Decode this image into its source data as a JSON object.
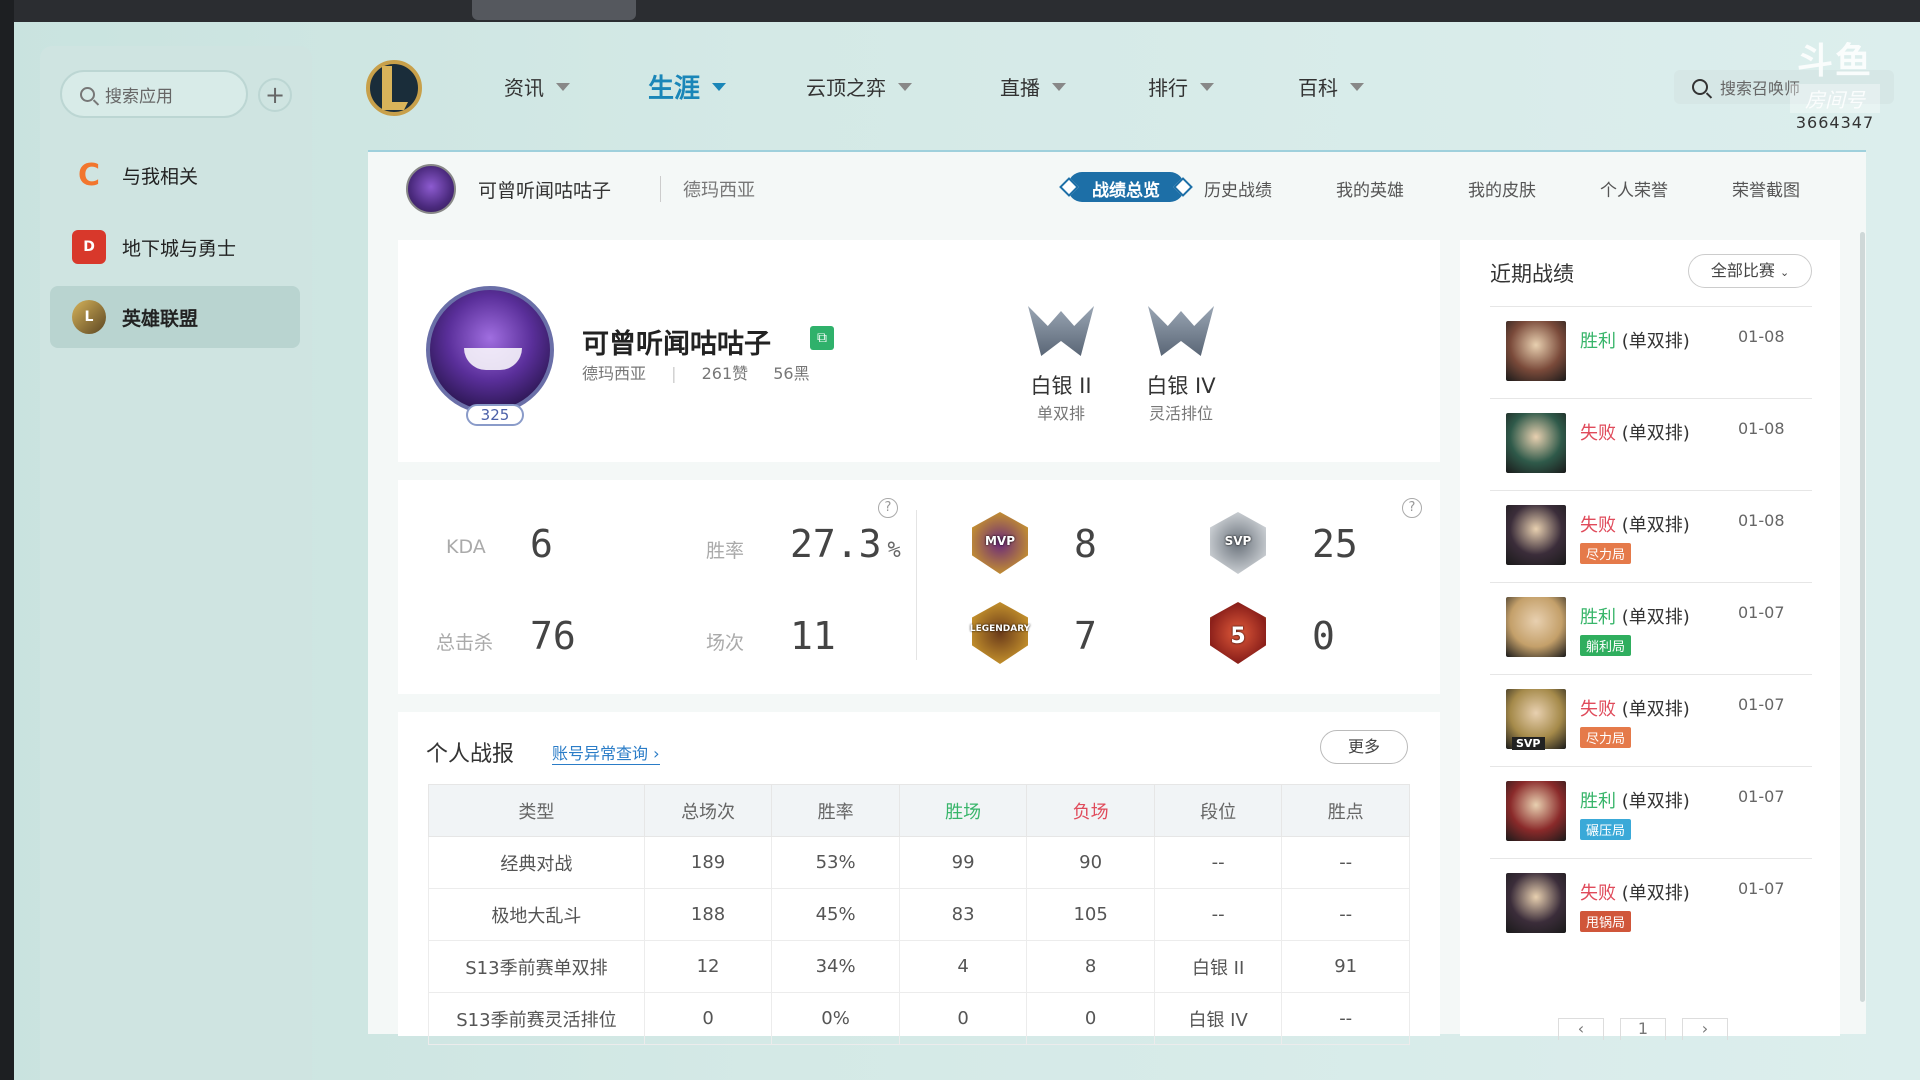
{
  "sidebar": {
    "search_placeholder": "搜索应用",
    "add": "+",
    "items": [
      {
        "label": "与我相关",
        "icon": "c-logo-icon",
        "color": "#f2762e"
      },
      {
        "label": "地下城与勇士",
        "icon": "dnf-logo-icon",
        "color": "#d8382b"
      },
      {
        "label": "英雄联盟",
        "icon": "lol-logo-icon",
        "color": "#b8923a",
        "active": true
      }
    ]
  },
  "nav": {
    "items": [
      {
        "label": "资讯"
      },
      {
        "label": "生涯",
        "active": true
      },
      {
        "label": "云顶之弈"
      },
      {
        "label": "直播"
      },
      {
        "label": "排行"
      },
      {
        "label": "百科"
      }
    ],
    "search_placeholder": "搜索召唤师"
  },
  "watermark": {
    "brand": "斗鱼",
    "room": "房间号",
    "id": "3664347"
  },
  "subhead": {
    "name": "可曾听闻咕咕子",
    "server": "德玛西亚",
    "tabs": [
      "战绩总览",
      "历史战绩",
      "我的英雄",
      "我的皮肤",
      "个人荣誉",
      "荣誉截图"
    ],
    "active_tab": "战绩总览"
  },
  "profile": {
    "name": "可曾听闻咕咕子",
    "level": "325",
    "server": "德玛西亚",
    "likes": "261赞",
    "blacks": "56黑",
    "ranks": [
      {
        "tier": "白银 II",
        "queue": "单双排"
      },
      {
        "tier": "白银 IV",
        "queue": "灵活排位"
      }
    ]
  },
  "stats": {
    "kda_label": "KDA",
    "kda": "6",
    "winrate_label": "胜率",
    "winrate": "27.3",
    "winrate_unit": "%",
    "kills_label": "总击杀",
    "kills": "76",
    "games_label": "场次",
    "games": "11",
    "help": "?",
    "badges": [
      {
        "name": "MVP",
        "value": "8",
        "color": "#c9962d"
      },
      {
        "name": "SVP",
        "value": "25",
        "color": "#9aa3ad"
      },
      {
        "name": "LEGENDARY",
        "value": "7",
        "color": "#b9862e"
      },
      {
        "name": "5",
        "value": "0",
        "color": "#c8462e"
      }
    ]
  },
  "report": {
    "title": "个人战报",
    "link": "账号异常查询",
    "more": "更多",
    "headers": [
      "类型",
      "总场次",
      "胜率",
      "胜场",
      "负场",
      "段位",
      "胜点"
    ],
    "rows": [
      [
        "经典对战",
        "189",
        "53%",
        "99",
        "90",
        "--",
        "--"
      ],
      [
        "极地大乱斗",
        "188",
        "45%",
        "83",
        "105",
        "--",
        "--"
      ],
      [
        "S13季前赛单双排",
        "12",
        "34%",
        "4",
        "8",
        "白银 II",
        "91"
      ],
      [
        "S13季前赛灵活排位",
        "0",
        "0%",
        "0",
        "0",
        "白银 IV",
        "--"
      ]
    ]
  },
  "recent": {
    "title": "近期战绩",
    "filter": "全部比赛",
    "matches": [
      {
        "result": "胜利",
        "mode": "(单双排)",
        "date": "01-08",
        "tag": "",
        "tag_color": "",
        "win": true,
        "color": "#7a4a3a"
      },
      {
        "result": "失败",
        "mode": "(单双排)",
        "date": "01-08",
        "tag": "",
        "tag_color": "",
        "win": false,
        "color": "#2f5a4a"
      },
      {
        "result": "失败",
        "mode": "(单双排)",
        "date": "01-08",
        "tag": "尽力局",
        "tag_color": "#e57a4a",
        "win": false,
        "color": "#3b2d3a"
      },
      {
        "result": "胜利",
        "mode": "(单双排)",
        "date": "01-07",
        "tag": "躺利局",
        "tag_color": "#2fae5e",
        "win": true,
        "color": "#c4a06a"
      },
      {
        "result": "失败",
        "mode": "(单双排)",
        "date": "01-07",
        "tag": "尽力局",
        "tag_color": "#e57a4a",
        "win": false,
        "color": "#a58a4a",
        "svp": "SVP"
      },
      {
        "result": "胜利",
        "mode": "(单双排)",
        "date": "01-07",
        "tag": "碾压局",
        "tag_color": "#3aa9d8",
        "win": true,
        "color": "#8a2a2a"
      },
      {
        "result": "失败",
        "mode": "(单双排)",
        "date": "01-07",
        "tag": "甩锅局",
        "tag_color": "#d0563a",
        "win": false,
        "color": "#3b2d3a"
      }
    ],
    "pager": {
      "prev": "‹",
      "page": "1",
      "next": "›"
    }
  }
}
